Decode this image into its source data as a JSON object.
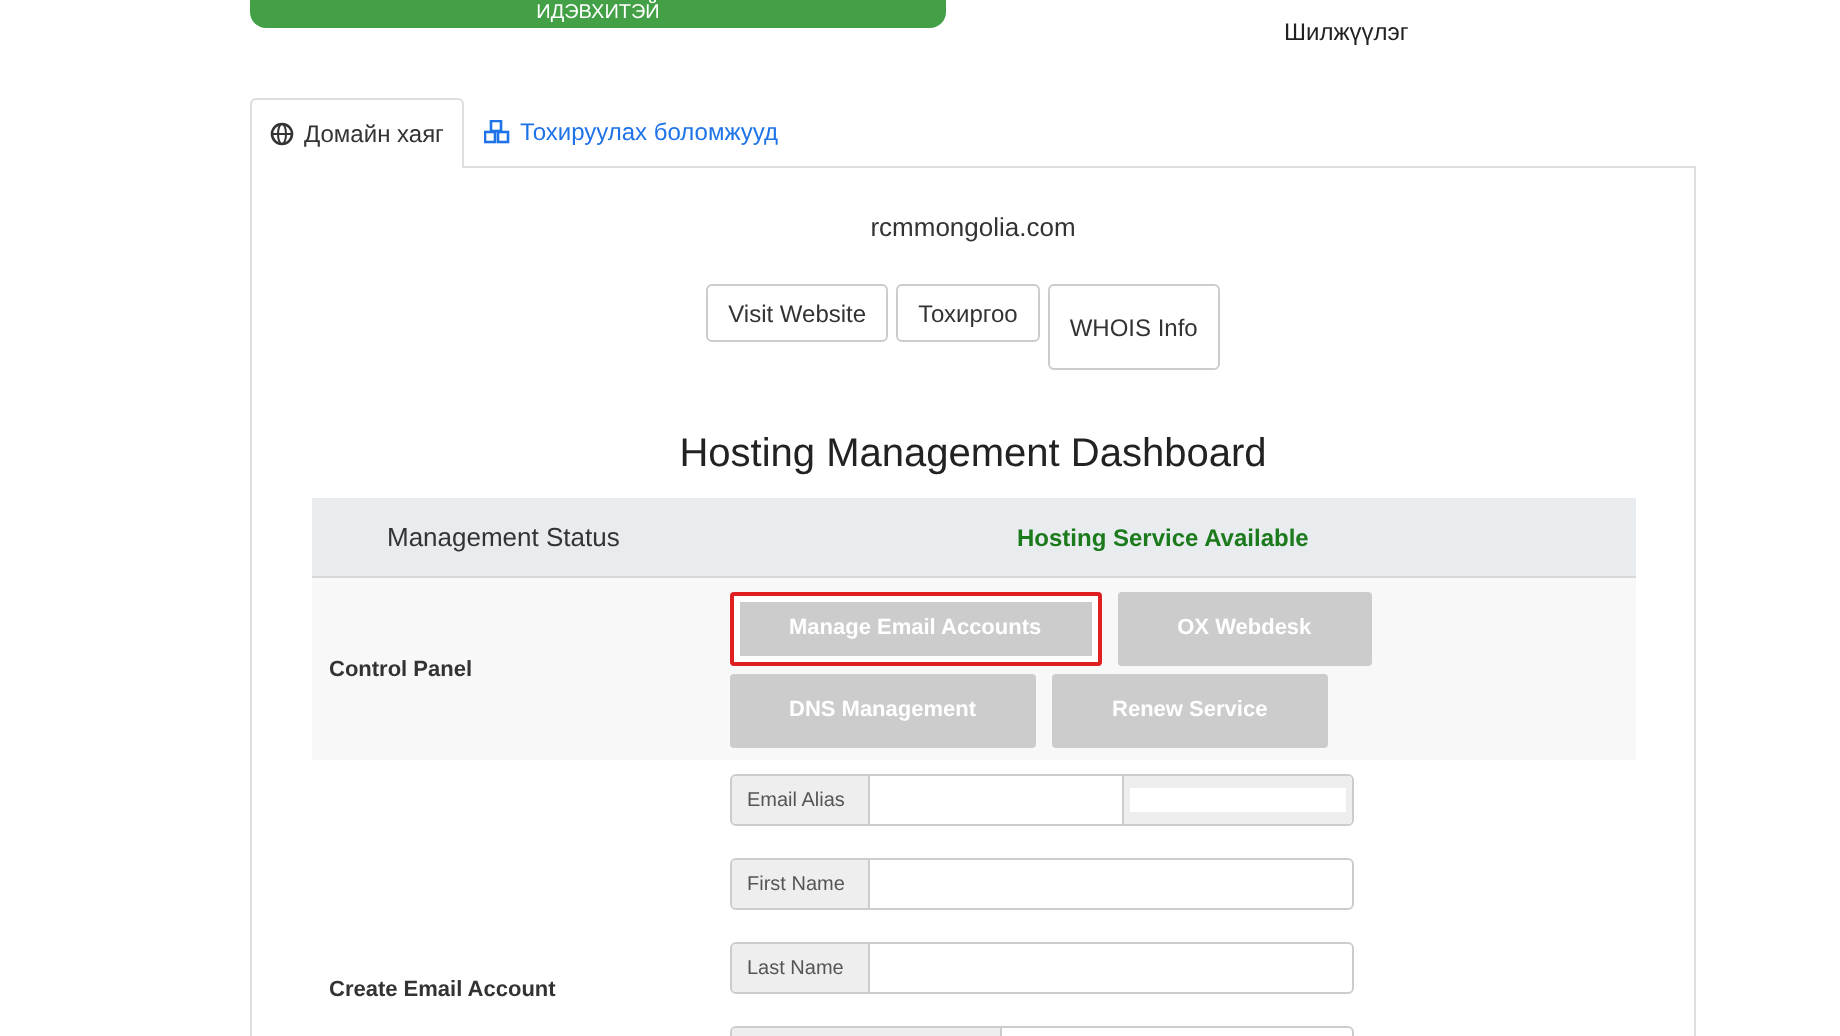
{
  "top_button": {
    "label": "ИДЭВХИТЭЙ"
  },
  "transfer_label": "Шилжүүлэг",
  "tabs": [
    {
      "label": "Домайн хаяг",
      "selected": true
    },
    {
      "label": "Тохируулах боломжууд",
      "selected": false
    }
  ],
  "domain": "rcmmongolia.com",
  "domain_buttons": [
    {
      "label": "Visit Website"
    },
    {
      "label": "Тохиргоо"
    },
    {
      "label": "WHOIS Info"
    }
  ],
  "heading": "Hosting Management Dashboard",
  "status_row": {
    "label": "Management Status",
    "value": "Hosting Service Available"
  },
  "control_panel": {
    "label": "Control Panel",
    "buttons": [
      {
        "label": "Manage Email Accounts",
        "highlighted": true
      },
      {
        "label": "OX Webdesk",
        "highlighted": false
      },
      {
        "label": "DNS Management",
        "highlighted": false
      },
      {
        "label": "Renew Service",
        "highlighted": false
      }
    ]
  },
  "create_email": {
    "label": "Create Email Account",
    "fields": [
      {
        "kind": "alias",
        "label": "Email Alias"
      },
      {
        "kind": "text",
        "label": "First Name"
      },
      {
        "kind": "text",
        "label": "Last Name"
      },
      {
        "kind": "cut"
      }
    ]
  }
}
